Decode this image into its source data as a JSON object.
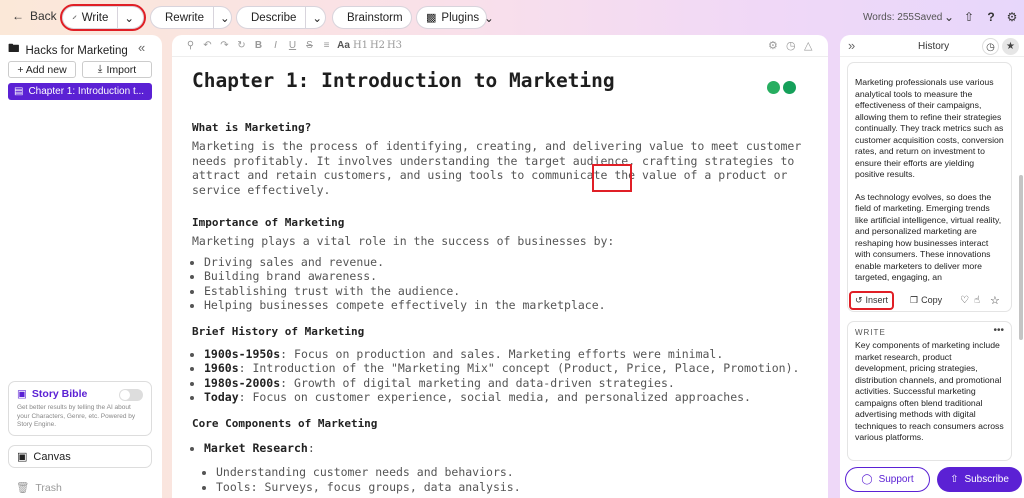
{
  "topbar": {
    "back_label": "Back",
    "write_label": "Write",
    "rewrite_label": "Rewrite",
    "describe_label": "Describe",
    "brainstorm_label": "Brainstorm",
    "plugins_label": "Plugins",
    "words": "Words: 255",
    "saved": "Saved"
  },
  "sidebar": {
    "project_title": "Hacks for Marketing",
    "add_new_label": "+ Add new",
    "import_label": "Import",
    "chapter_item": "Chapter 1: Introduction t...",
    "story_bible": {
      "title": "Story Bible",
      "description": "Get better results by telling the AI about your Characters, Genre, etc. Powered by Story Engine."
    },
    "canvas_label": "Canvas",
    "trash_label": "Trash"
  },
  "toolbar": {
    "bold": "B",
    "italic": "I",
    "underline": "U",
    "strike": "S",
    "text_style": "Aa",
    "h1": "H1",
    "h2": "H2",
    "h3": "H3"
  },
  "document": {
    "title": "Chapter 1: Introduction to Marketing",
    "sections": {
      "what_heading": "What is Marketing?",
      "what_para": "Marketing is the process of identifying, creating, and delivering value to meet customer needs profitably. It involves understanding the target audience, crafting strategies to attract and retain customers, and using tools to communicate the value of a product or service effectively.",
      "importance_heading": "Importance of Marketing",
      "importance_intro": "Marketing plays a vital role in the success of businesses by:",
      "importance_items": [
        "Driving sales and revenue.",
        "Building brand awareness.",
        "Establishing trust with the audience.",
        "Helping businesses compete effectively in the marketplace."
      ],
      "history_heading": "Brief History of Marketing",
      "history_items": [
        {
          "label": "1900s-1950s",
          "text": ": Focus on production and sales. Marketing efforts were minimal."
        },
        {
          "label": "1960s",
          "text": ": Introduction of the \"Marketing Mix\" concept (Product, Price, Place, Promotion)."
        },
        {
          "label": "1980s-2000s",
          "text": ": Growth of digital marketing and data-driven strategies."
        },
        {
          "label": "Today",
          "text": ": Focus on customer experience, social media, and personalized approaches."
        }
      ],
      "core_heading": "Core Components of Marketing",
      "market_research_label": "Market Research",
      "market_research_colon": ":",
      "market_research_items": [
        "Understanding customer needs and behaviors.",
        "Tools: Surveys, focus groups, data analysis."
      ]
    }
  },
  "history": {
    "title": "History",
    "card1": {
      "para1": "Marketing professionals use various analytical tools to measure the effectiveness of their campaigns, allowing them to refine their strategies continually. They track metrics such as customer acquisition costs, conversion rates, and return on investment to ensure their efforts are yielding positive results.",
      "para2": "As technology evolves, so does the field of marketing. Emerging trends like artificial intelligence, virtual reality, and personalized marketing are reshaping how businesses interact with consumers. These innovations enable marketers to deliver more targeted, engaging, an",
      "insert_label": "Insert",
      "copy_label": "Copy"
    },
    "card2": {
      "label": "WRITE",
      "text": "Key components of marketing include market research, product development, pricing strategies, distribution channels, and promotional activities. Successful marketing campaigns often blend traditional advertising methods with digital techniques to reach consumers across various platforms."
    }
  },
  "footer": {
    "support_label": "Support",
    "subscribe_label": "Subscribe"
  },
  "colors": {
    "accent": "#5b21d4",
    "highlight": "#e01f26"
  }
}
